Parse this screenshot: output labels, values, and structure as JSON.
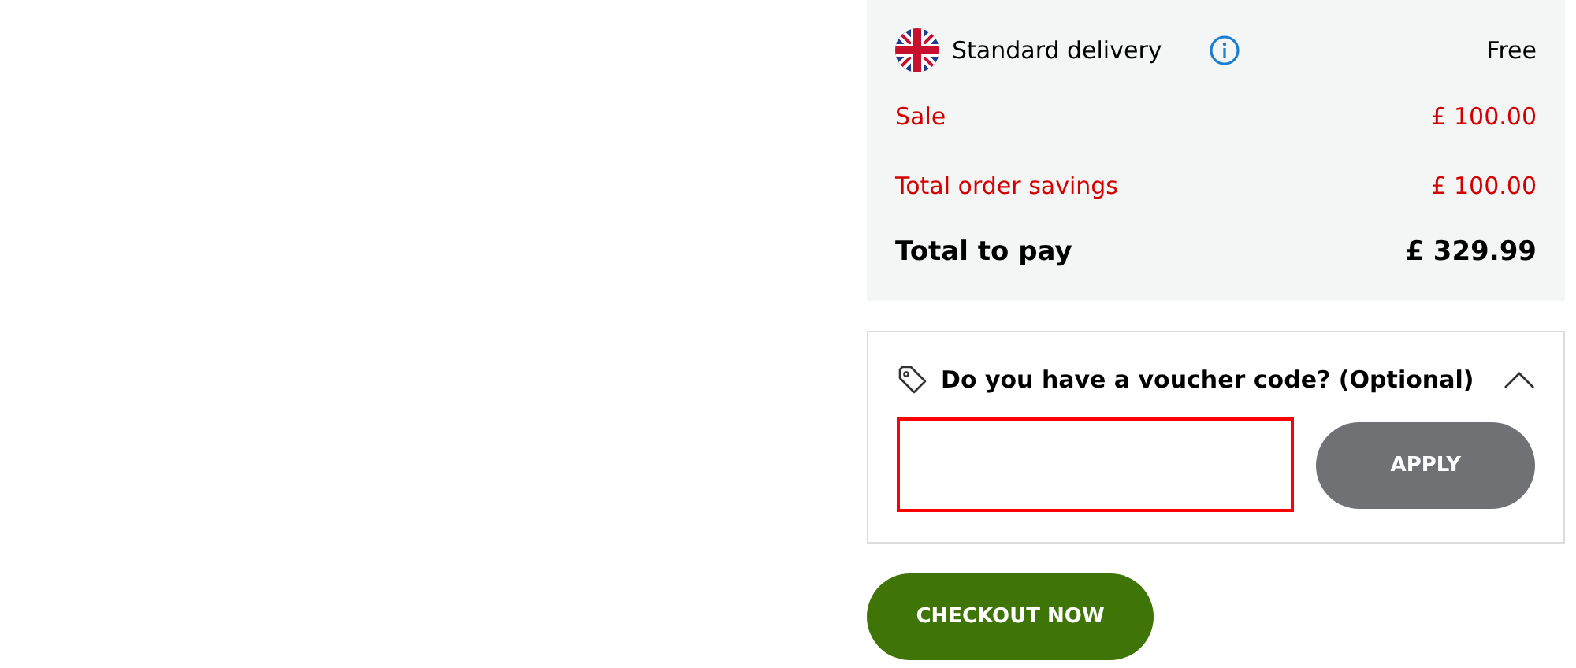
{
  "summary": {
    "rows": [
      {
        "kind": "delivery",
        "label": "Standard delivery",
        "value": "Free"
      },
      {
        "kind": "saving",
        "label": "Sale",
        "value": "£ 100.00"
      },
      {
        "kind": "saving",
        "label": "Total order savings",
        "value": "£ 100.00"
      },
      {
        "kind": "total",
        "label": "Total to pay",
        "value": "£ 329.99"
      }
    ]
  },
  "voucher": {
    "title": "Do you have a voucher code? (Optional)",
    "expanded": true,
    "field": {
      "error": true
    },
    "apply": {
      "label": "APPLY",
      "disabled": true
    }
  },
  "checkout": {
    "label": "CHECKOUT NOW"
  }
}
